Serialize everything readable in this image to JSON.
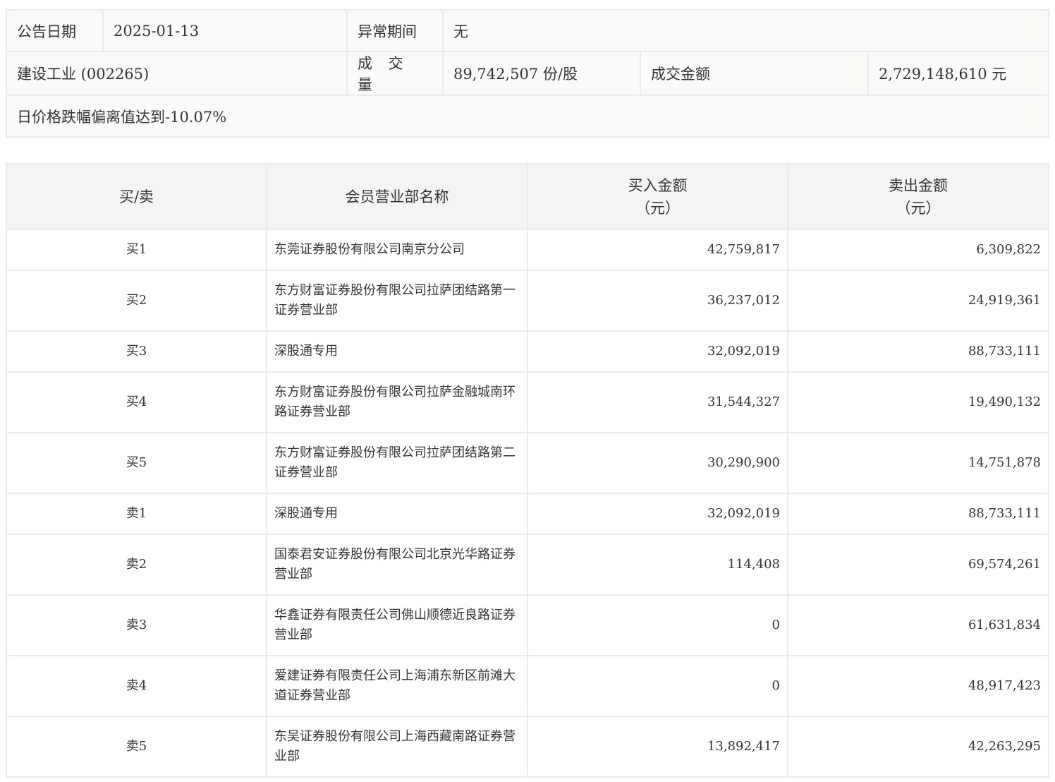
{
  "info": {
    "date_label": "公告日期",
    "date_value": "2025-01-13",
    "period_label": "异常期间",
    "period_value": "无",
    "stock": "建设工业 (002265)",
    "volume_label": "成 交 量",
    "volume_value": "89,742,507 份/股",
    "amount_label": "成交金额",
    "amount_value": "2,729,148,610 元",
    "reason": "日价格跌幅偏离值达到-10.07%"
  },
  "table": {
    "headers": {
      "side": "买/卖",
      "name": "会员营业部名称",
      "buy": "买入金额",
      "buy_unit": "（元）",
      "sell": "卖出金额",
      "sell_unit": "（元）"
    },
    "rows": [
      {
        "side": "买1",
        "name": "东莞证券股份有限公司南京分公司",
        "buy": "42,759,817",
        "sell": "6,309,822"
      },
      {
        "side": "买2",
        "name": "东方财富证券股份有限公司拉萨团结路第一证券营业部",
        "buy": "36,237,012",
        "sell": "24,919,361"
      },
      {
        "side": "买3",
        "name": "深股通专用",
        "buy": "32,092,019",
        "sell": "88,733,111"
      },
      {
        "side": "买4",
        "name": "东方财富证券股份有限公司拉萨金融城南环路证券营业部",
        "buy": "31,544,327",
        "sell": "19,490,132"
      },
      {
        "side": "买5",
        "name": "东方财富证券股份有限公司拉萨团结路第二证券营业部",
        "buy": "30,290,900",
        "sell": "14,751,878"
      },
      {
        "side": "卖1",
        "name": "深股通专用",
        "buy": "32,092,019",
        "sell": "88,733,111"
      },
      {
        "side": "卖2",
        "name": "国泰君安证券股份有限公司北京光华路证券营业部",
        "buy": "114,408",
        "sell": "69,574,261"
      },
      {
        "side": "卖3",
        "name": "华鑫证券有限责任公司佛山顺德近良路证券营业部",
        "buy": "0",
        "sell": "61,631,834"
      },
      {
        "side": "卖4",
        "name": "爱建证券有限责任公司上海浦东新区前滩大道证券营业部",
        "buy": "0",
        "sell": "48,917,423"
      },
      {
        "side": "卖5",
        "name": "东吴证券股份有限公司上海西藏南路证券营业部",
        "buy": "13,892,417",
        "sell": "42,263,295"
      }
    ]
  }
}
